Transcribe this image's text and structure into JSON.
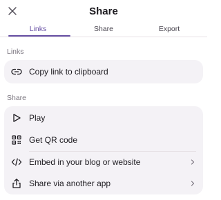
{
  "header": {
    "title": "Share",
    "close_icon": "close-icon"
  },
  "tabs": [
    {
      "label": "Links",
      "active": true
    },
    {
      "label": "Share",
      "active": false
    },
    {
      "label": "Export",
      "active": false
    }
  ],
  "sections": {
    "links": {
      "label": "Links",
      "items": [
        {
          "label": "Copy link to clipboard",
          "icon": "link-icon"
        }
      ]
    },
    "share": {
      "label": "Share",
      "items": [
        {
          "label": "Play",
          "icon": "play-icon",
          "chevron": false
        },
        {
          "label": "Get QR code",
          "icon": "qr-code-icon",
          "chevron": false
        },
        {
          "label": "Embed in your blog or website",
          "icon": "code-icon",
          "chevron": true
        },
        {
          "label": "Share via another app",
          "icon": "share-upload-icon",
          "chevron": true
        }
      ]
    }
  },
  "colors": {
    "accent": "#6750a4",
    "card_background": "#f4f2f6",
    "text_primary": "#1d1b20",
    "text_secondary": "#79747e"
  }
}
